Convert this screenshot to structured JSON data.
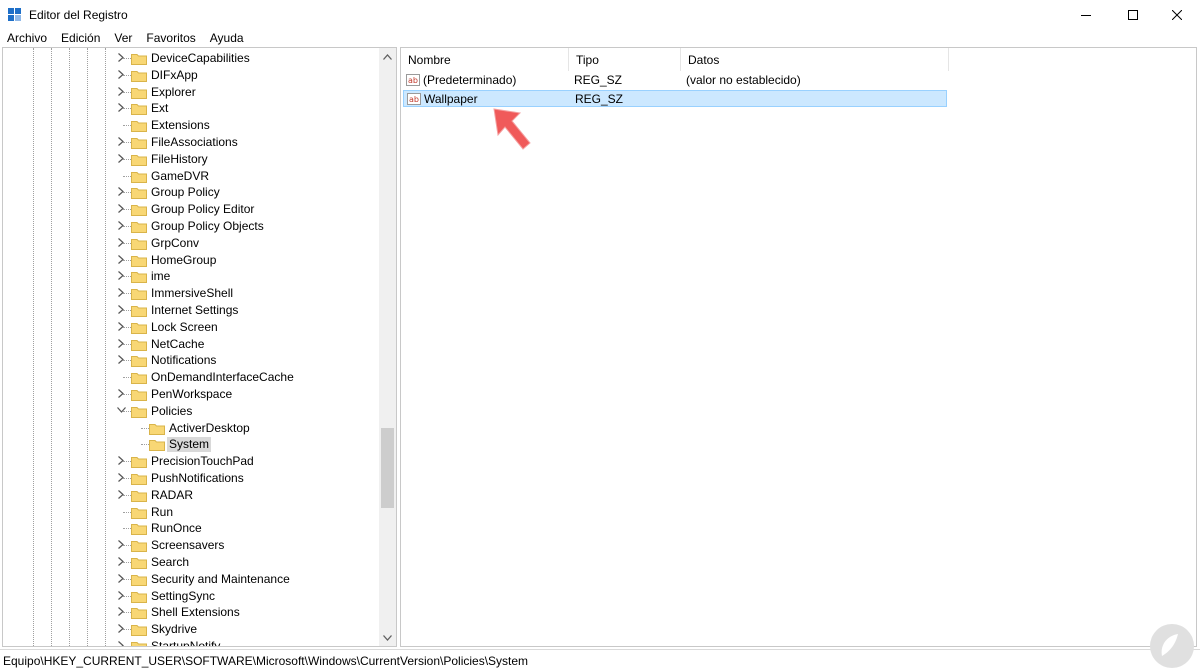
{
  "window": {
    "title": "Editor del Registro",
    "icon": "regedit-icon",
    "controls": [
      "minimize-icon",
      "maximize-icon",
      "close-icon"
    ]
  },
  "menu": [
    "Archivo",
    "Edición",
    "Ver",
    "Favoritos",
    "Ayuda"
  ],
  "tree": {
    "items": [
      {
        "label": "DeviceCapabilities",
        "expander": "collapsed",
        "level": 0
      },
      {
        "label": "DIFxApp",
        "expander": "collapsed",
        "level": 0
      },
      {
        "label": "Explorer",
        "expander": "collapsed",
        "level": 0
      },
      {
        "label": "Ext",
        "expander": "collapsed",
        "level": 0
      },
      {
        "label": "Extensions",
        "expander": "none",
        "level": 0
      },
      {
        "label": "FileAssociations",
        "expander": "collapsed",
        "level": 0
      },
      {
        "label": "FileHistory",
        "expander": "collapsed",
        "level": 0
      },
      {
        "label": "GameDVR",
        "expander": "none",
        "level": 0
      },
      {
        "label": "Group Policy",
        "expander": "collapsed",
        "level": 0
      },
      {
        "label": "Group Policy Editor",
        "expander": "collapsed",
        "level": 0
      },
      {
        "label": "Group Policy Objects",
        "expander": "collapsed",
        "level": 0
      },
      {
        "label": "GrpConv",
        "expander": "collapsed",
        "level": 0
      },
      {
        "label": "HomeGroup",
        "expander": "collapsed",
        "level": 0
      },
      {
        "label": "ime",
        "expander": "collapsed",
        "level": 0
      },
      {
        "label": "ImmersiveShell",
        "expander": "collapsed",
        "level": 0
      },
      {
        "label": "Internet Settings",
        "expander": "collapsed",
        "level": 0
      },
      {
        "label": "Lock Screen",
        "expander": "collapsed",
        "level": 0
      },
      {
        "label": "NetCache",
        "expander": "collapsed",
        "level": 0
      },
      {
        "label": "Notifications",
        "expander": "collapsed",
        "level": 0
      },
      {
        "label": "OnDemandInterfaceCache",
        "expander": "none",
        "level": 0
      },
      {
        "label": "PenWorkspace",
        "expander": "collapsed",
        "level": 0
      },
      {
        "label": "Policies",
        "expander": "expanded",
        "level": 0
      },
      {
        "label": "ActiverDesktop",
        "expander": "none",
        "level": 1
      },
      {
        "label": "System",
        "expander": "none",
        "level": 1,
        "selected": true
      },
      {
        "label": "PrecisionTouchPad",
        "expander": "collapsed",
        "level": 0
      },
      {
        "label": "PushNotifications",
        "expander": "collapsed",
        "level": 0
      },
      {
        "label": "RADAR",
        "expander": "collapsed",
        "level": 0
      },
      {
        "label": "Run",
        "expander": "none",
        "level": 0
      },
      {
        "label": "RunOnce",
        "expander": "none",
        "level": 0
      },
      {
        "label": "Screensavers",
        "expander": "collapsed",
        "level": 0
      },
      {
        "label": "Search",
        "expander": "collapsed",
        "level": 0
      },
      {
        "label": "Security and Maintenance",
        "expander": "collapsed",
        "level": 0
      },
      {
        "label": "SettingSync",
        "expander": "collapsed",
        "level": 0
      },
      {
        "label": "Shell Extensions",
        "expander": "collapsed",
        "level": 0
      },
      {
        "label": "Skydrive",
        "expander": "collapsed",
        "level": 0
      },
      {
        "label": "StartupNotify",
        "expander": "collapsed",
        "level": 0
      }
    ]
  },
  "list": {
    "columns": [
      "Nombre",
      "Tipo",
      "Datos"
    ],
    "rows": [
      {
        "name": "(Predeterminado)",
        "type": "REG_SZ",
        "data": "(valor no establecido)",
        "icon": "string-value-icon"
      },
      {
        "name": "Wallpaper",
        "type": "REG_SZ",
        "data": "",
        "icon": "string-value-icon",
        "selected": true
      }
    ]
  },
  "annotation": {
    "icon": "pointer-arrow-icon",
    "color": "#f05a5a"
  },
  "statusbar": {
    "path": "Equipo\\HKEY_CURRENT_USER\\SOFTWARE\\Microsoft\\Windows\\CurrentVersion\\Policies\\System"
  },
  "colors": {
    "folder": "#f8d775",
    "selection": "#cce8ff",
    "tree_selection": "#d9d9d9"
  }
}
